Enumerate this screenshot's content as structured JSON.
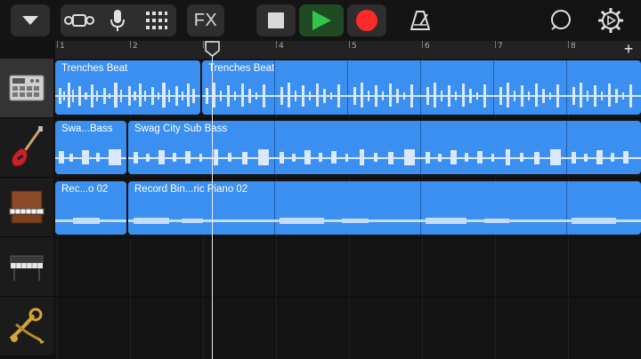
{
  "toolbar": {
    "fx_label": "FX"
  },
  "ruler": {
    "bars": [
      "1",
      "2",
      "3",
      "4",
      "5",
      "6",
      "7",
      "8"
    ],
    "add_label": "+"
  },
  "tracks": [
    {
      "icon": "drum-machine-icon",
      "regions": [
        "Trenches Beat",
        "Trenches Beat"
      ]
    },
    {
      "icon": "bass-guitar-icon",
      "regions": [
        "Swa...Bass",
        "Swag City Sub Bass"
      ]
    },
    {
      "icon": "upright-piano-icon",
      "regions": [
        "Rec...o 02",
        "Record Bin...ric Piano 02"
      ]
    },
    {
      "icon": "keyboard-icon",
      "regions": []
    },
    {
      "icon": "horns-icon",
      "regions": []
    }
  ],
  "colors": {
    "region": "#3b8ff0",
    "play": "#35c44a",
    "record": "#ff2a2a"
  }
}
